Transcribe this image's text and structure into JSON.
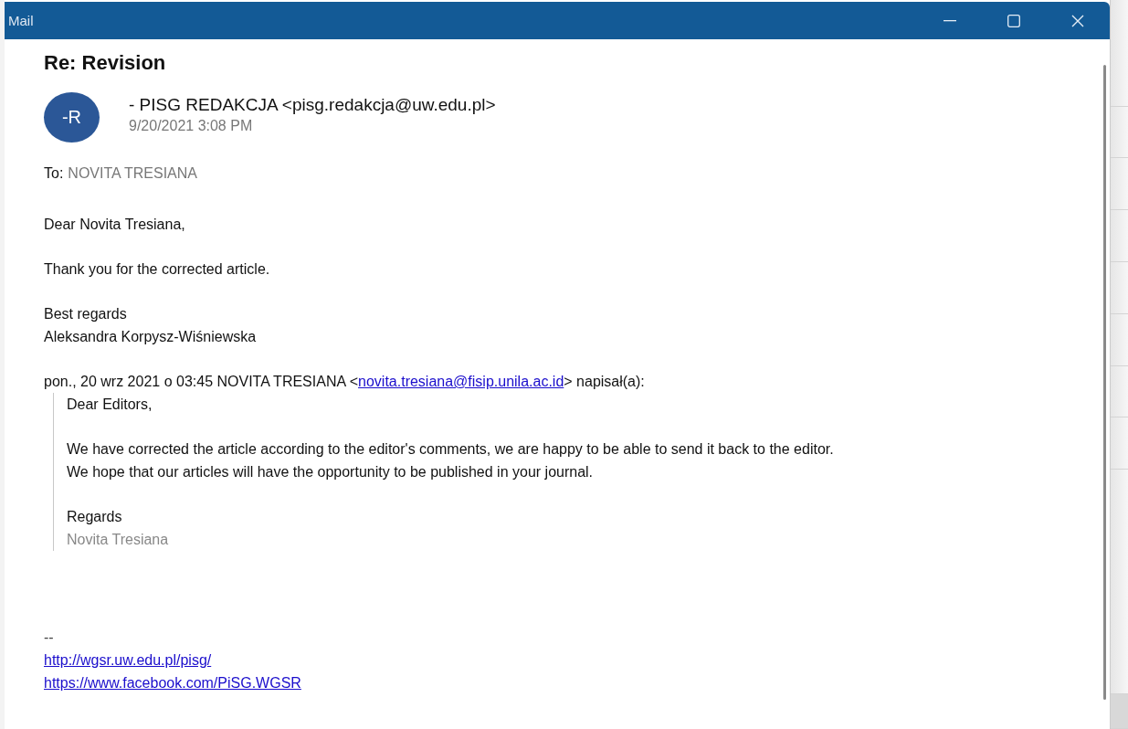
{
  "window": {
    "title": "Mail"
  },
  "message": {
    "subject": "Re: Revision",
    "avatar": "-R",
    "sender": "- PISG REDAKCJA <pisg.redakcja@uw.edu.pl>",
    "date": "9/20/2021 3:08 PM",
    "to_label": "To:",
    "to": "NOVITA TRESIANA",
    "body": [
      {
        "kind": "text",
        "lines": [
          "Dear Novita Tresiana,"
        ]
      },
      {
        "kind": "text",
        "lines": [
          "Thank you for the corrected article."
        ]
      },
      {
        "kind": "text",
        "lines": [
          "Best regards",
          "Aleksandra Korpysz-Wiśniewska"
        ]
      },
      {
        "kind": "attribution",
        "before": "pon., 20 wrz 2021 o 03:45 NOVITA TRESIANA <",
        "link": "novita.tresiana@fisip.unila.ac.id",
        "after": "> napisał(a):"
      },
      {
        "kind": "quote",
        "paragraphs": [
          {
            "lines": [
              "Dear Editors,"
            ]
          },
          {
            "lines": [
              "We have corrected the article according to the editor's comments, we are happy to be able to send it back to the editor.",
              "We hope that our articles will have the opportunity to be published in your journal."
            ]
          },
          {
            "lines": [
              "Regards"
            ],
            "signature": "Novita Tresiana"
          }
        ]
      },
      {
        "kind": "signature",
        "separator": "--",
        "links": [
          "http://wgsr.uw.edu.pl/pisg/",
          "https://www.facebook.com/PiSG.WGSR"
        ]
      }
    ]
  }
}
